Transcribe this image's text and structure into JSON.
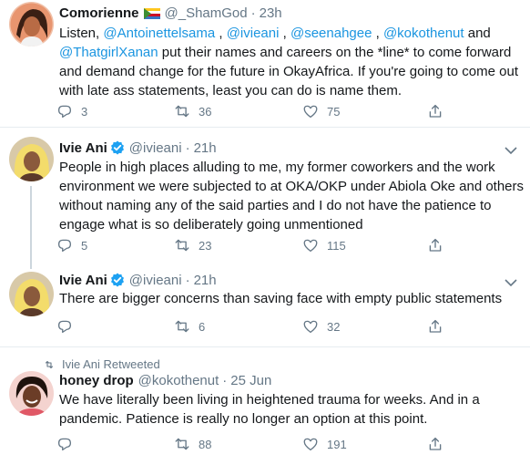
{
  "tweets": [
    {
      "name": "Comorienne",
      "flag_icon": "comoros-flag-icon",
      "handle": "@_ShamGod",
      "time": "23h",
      "lines": [
        [
          {
            "t": "Listen, "
          },
          {
            "m": "@Antoinettelsama"
          },
          {
            "t": " , "
          },
          {
            "m": "@ivieani"
          },
          {
            "t": " , "
          },
          {
            "m": "@seenahgee"
          },
          {
            "t": " , "
          },
          {
            "m": "@kokothenut"
          },
          {
            "t": " and"
          }
        ],
        [
          {
            "m": "@ThatgirlXanan"
          },
          {
            "t": " put their names and careers on the *line* to come forward"
          }
        ],
        [
          {
            "t": "and demand change for the future in OkayAfrica. If you're going to come out"
          }
        ],
        [
          {
            "t": "with late ass statements, least you can do is name them."
          }
        ]
      ],
      "replies": "3",
      "retweets": "36",
      "likes": "75"
    },
    {
      "name": "Ivie Ani",
      "handle": "@ivieani",
      "time": "21h",
      "verified": true,
      "lines": [
        [
          {
            "t": "People in high places alluding to me, my former coworkers and the work"
          }
        ],
        [
          {
            "t": "environment we were subjected to at OKA/OKP under Abiola Oke and others"
          }
        ],
        [
          {
            "t": "without naming any of the said parties and I do not have the patience to"
          }
        ],
        [
          {
            "t": "engage what is so deliberately going unmentioned"
          }
        ]
      ],
      "replies": "5",
      "retweets": "23",
      "likes": "115"
    },
    {
      "name": "Ivie Ani",
      "handle": "@ivieani",
      "time": "21h",
      "verified": true,
      "lines": [
        [
          {
            "t": "There are bigger concerns than saving face with empty public statements"
          }
        ]
      ],
      "replies": "",
      "retweets": "6",
      "likes": "32"
    },
    {
      "retweet_context": "Ivie Ani Retweeted",
      "name": "honey drop",
      "handle": "@kokothenut",
      "time": "25 Jun",
      "lines": [
        [
          {
            "t": "We have literally been living in heightened trauma for weeks. And in a"
          }
        ],
        [
          {
            "t": "pandemic. Patience is really no longer an option at this point."
          }
        ]
      ],
      "replies": "",
      "retweets": "88",
      "likes": "191"
    }
  ],
  "dot": "·",
  "colors": {
    "mention": "#1b95e0",
    "secondary_text": "#657786",
    "verified": "#1da1f2",
    "divider": "#e6ecf0"
  },
  "icons": {
    "reply": "reply-icon",
    "retweet": "retweet-icon",
    "like": "heart-icon",
    "share": "share-icon",
    "caret": "chevron-down-icon",
    "verified": "verified-badge-icon"
  }
}
